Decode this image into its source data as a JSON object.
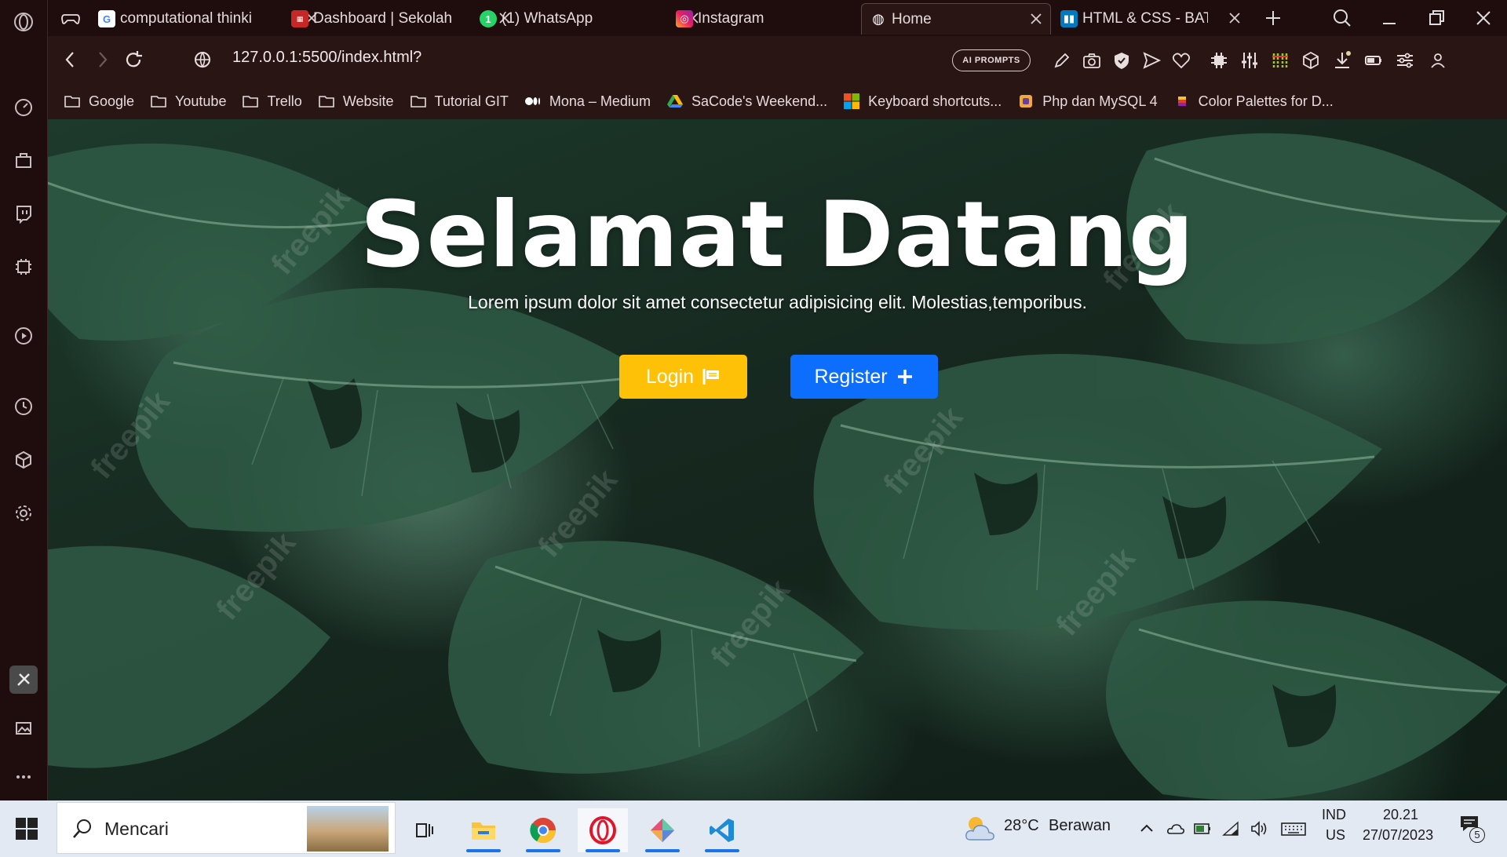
{
  "browser": {
    "tabs": [
      {
        "title": "computational thinki",
        "favicon": "google-icon",
        "active": false
      },
      {
        "title": "Dashboard | Sekolah",
        "favicon": "sekolah-icon",
        "active": false
      },
      {
        "title": "(1) WhatsApp",
        "favicon": "whatsapp-icon",
        "active": false
      },
      {
        "title": "Instagram",
        "favicon": "instagram-icon",
        "active": false
      },
      {
        "title": "Home",
        "favicon": "globe-icon",
        "active": true
      },
      {
        "title": "HTML & CSS - BATC",
        "favicon": "trello-icon",
        "active": false
      }
    ],
    "url": "127.0.0.1:5500/index.html?",
    "ai_prompts_label": "AI PROMPTS",
    "whatsapp_badge": "1",
    "bookmarks": [
      {
        "label": "Google",
        "icon": "folder-icon"
      },
      {
        "label": "Youtube",
        "icon": "folder-icon"
      },
      {
        "label": "Trello",
        "icon": "folder-icon"
      },
      {
        "label": "Website",
        "icon": "folder-icon"
      },
      {
        "label": "Tutorial GIT",
        "icon": "folder-icon"
      },
      {
        "label": "Mona – Medium",
        "icon": "medium-icon"
      },
      {
        "label": "SaCode's Weekend...",
        "icon": "drive-icon"
      },
      {
        "label": "Keyboard shortcuts...",
        "icon": "microsoft-icon"
      },
      {
        "label": "Php dan MySQL 4",
        "icon": "php-icon"
      },
      {
        "label": "Color Palettes for D...",
        "icon": "palette-icon"
      }
    ]
  },
  "page": {
    "title": "Selamat Datang",
    "subtitle": "Lorem ipsum dolor sit amet consectetur adipisicing elit. Molestias,temporibus.",
    "login_label": "Login",
    "register_label": "Register",
    "watermark": "freepik",
    "colors": {
      "login": "#ffc107",
      "register": "#0d6efd"
    }
  },
  "taskbar": {
    "search_placeholder": "Mencari",
    "weather_temp": "28°C",
    "weather_desc": "Berawan",
    "lang_top": "IND",
    "lang_bottom": "US",
    "time": "20.21",
    "date": "27/07/2023",
    "notifications": "5"
  }
}
